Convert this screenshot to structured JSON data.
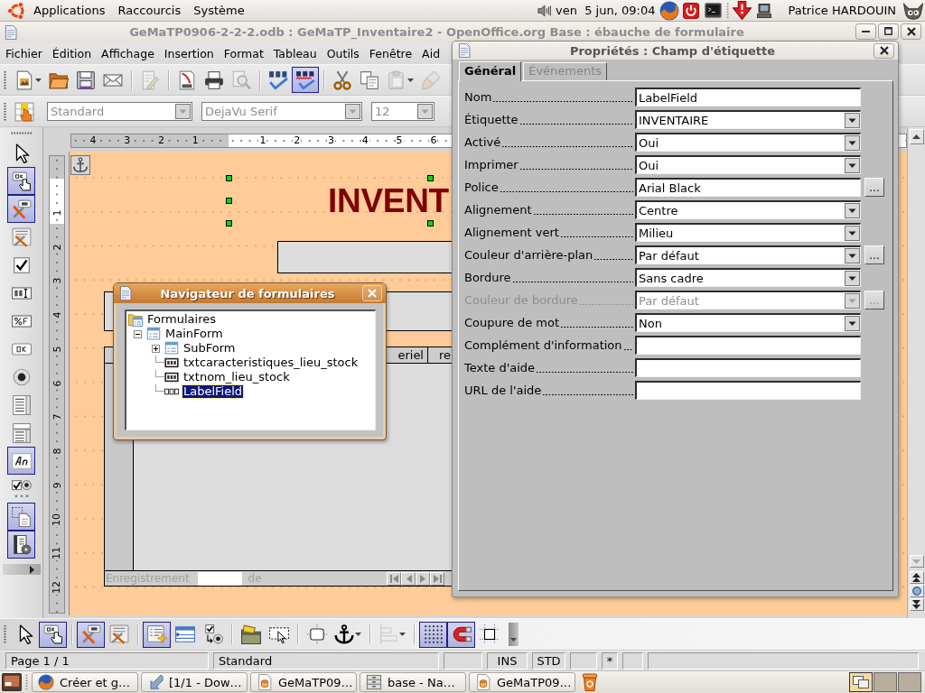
{
  "top_panel": {
    "menus": [
      "Applications",
      "Raccourcis",
      "Système"
    ],
    "clock": "ven  5 jun, 09:04",
    "user": "Patrice HARDOUIN"
  },
  "window": {
    "title": "GeMaTP0906-2-2-2.odb : GeMaTP_Inventaire2 - OpenOffice.org Base : ébauche de formulaire"
  },
  "menu_bar": [
    "Fichier",
    "Édition",
    "Affichage",
    "Insertion",
    "Format",
    "Tableau",
    "Outils",
    "Fenêtre",
    "Aid"
  ],
  "standard_toolbar": [
    [
      {
        "kind": "new",
        "on": false,
        "disabled": false,
        "menu": true
      },
      {
        "kind": "open",
        "on": false,
        "disabled": false
      },
      {
        "kind": "save",
        "on": false,
        "disabled": false
      },
      {
        "kind": "mail",
        "on": false,
        "disabled": false
      }
    ],
    [
      {
        "kind": "edit",
        "on": false,
        "disabled": true
      }
    ],
    [
      {
        "kind": "pdf",
        "on": false,
        "disabled": false
      },
      {
        "kind": "print",
        "on": false,
        "disabled": false
      },
      {
        "kind": "preview",
        "on": false,
        "disabled": true
      }
    ],
    [
      {
        "kind": "spellcheck",
        "on": false,
        "disabled": false
      },
      {
        "kind": "autospell",
        "on": true,
        "disabled": false
      }
    ],
    [
      {
        "kind": "cut",
        "on": false,
        "disabled": false
      },
      {
        "kind": "copy",
        "on": false,
        "disabled": false
      },
      {
        "kind": "paste",
        "on": false,
        "disabled": true,
        "menu": true
      },
      {
        "kind": "brush",
        "on": false,
        "disabled": true
      }
    ]
  ],
  "format_toolbar": {
    "tool": {
      "kind": "form-design",
      "on": false,
      "disabled": false
    },
    "paragraph_style": {
      "value": "Standard",
      "disabled": true
    },
    "font_name": {
      "value": "DejaVu Serif",
      "disabled": true
    },
    "font_size": {
      "value": "12",
      "disabled": true
    }
  },
  "controls_toolbar": [
    {
      "kind": "pointer",
      "on": false,
      "disabled": false
    },
    {
      "kind": "design-mode",
      "on": true,
      "disabled": false
    },
    {
      "kind": "control-properties",
      "on": true,
      "disabled": false
    },
    {
      "kind": "form-properties",
      "on": false,
      "disabled": false
    },
    {
      "kind": "checkbox",
      "on": false,
      "disabled": false
    },
    {
      "kind": "text-field",
      "on": false,
      "disabled": false
    },
    {
      "kind": "formatted-field",
      "on": false,
      "disabled": false
    },
    {
      "kind": "push-button",
      "on": false,
      "disabled": false
    },
    {
      "kind": "radio",
      "on": false,
      "disabled": false
    },
    {
      "kind": "list-box",
      "on": false,
      "disabled": false
    },
    {
      "kind": "combo-box",
      "on": false,
      "disabled": false
    },
    {
      "kind": "label",
      "on": true,
      "disabled": false
    },
    {
      "kind": "group-box",
      "on": false,
      "disabled": false
    },
    {
      "kind": "form-frame",
      "on": true,
      "disabled": false
    },
    {
      "kind": "form-wizard",
      "on": true,
      "disabled": false
    }
  ],
  "rulers": {
    "horizontal": {
      "before_origin": [
        "4",
        "3",
        "2",
        "1"
      ],
      "after_origin": [
        "1",
        "2",
        "3",
        "4",
        "5",
        "6"
      ]
    },
    "vertical": [
      "1",
      "2",
      "3",
      "4",
      "5",
      "6",
      "7",
      "8",
      "9",
      "10",
      "11",
      "12"
    ]
  },
  "form": {
    "label": {
      "text": "INVENT",
      "selected": true
    },
    "grid": {
      "columns": [
        "eriel",
        "re"
      ],
      "record_label": "Enregistrement",
      "record_of": "de"
    }
  },
  "form_navigator": {
    "title": "Navigateur de formulaires",
    "tree": [
      {
        "label": "Formulaires",
        "kind": "forms",
        "selected": false,
        "children": [
          {
            "label": "MainForm",
            "kind": "form",
            "expanded": true,
            "selected": false,
            "children": [
              {
                "label": "SubForm",
                "kind": "form",
                "expanded": false,
                "selected": false
              },
              {
                "label": "txtcaracteristiques_lieu_stock",
                "kind": "text-box",
                "selected": false
              },
              {
                "label": "txtnom_lieu_stock",
                "kind": "text-box",
                "selected": false
              },
              {
                "label": "LabelField",
                "kind": "label",
                "selected": true
              }
            ]
          }
        ]
      }
    ]
  },
  "properties_dialog": {
    "title": "Propriétés : Champ d'étiquette",
    "tabs": [
      {
        "label": "Général",
        "selected": true
      },
      {
        "label": "Événements",
        "selected": false
      }
    ],
    "rows": [
      {
        "label": "Nom",
        "kind": "text",
        "value": "LabelField",
        "disabled": false
      },
      {
        "label": "Étiquette",
        "kind": "select",
        "value": "INVENTAIRE",
        "disabled": false
      },
      {
        "label": "Activé",
        "kind": "select",
        "value": "Oui",
        "disabled": false
      },
      {
        "label": "Imprimer",
        "kind": "select",
        "value": "Oui",
        "disabled": false
      },
      {
        "label": "Police",
        "kind": "text",
        "value": "Arial Black",
        "disabled": false,
        "button": "..."
      },
      {
        "label": "Alignement",
        "kind": "select",
        "value": "Centre",
        "disabled": false
      },
      {
        "label": "Alignement vert",
        "kind": "select",
        "value": "Milieu",
        "disabled": false
      },
      {
        "label": "Couleur d'arrière-plan",
        "kind": "select",
        "value": "Par défaut",
        "disabled": false,
        "button": "..."
      },
      {
        "label": "Bordure",
        "kind": "select",
        "value": "Sans cadre",
        "disabled": false
      },
      {
        "label": "Couleur de bordure",
        "kind": "select",
        "value": "Par défaut",
        "disabled": true,
        "button": "..."
      },
      {
        "label": "Coupure de mot",
        "kind": "select",
        "value": "Non",
        "disabled": false
      },
      {
        "label": "Complément d'information",
        "kind": "text",
        "disabled": false
      },
      {
        "label": "Texte d'aide",
        "kind": "text",
        "disabled": false
      },
      {
        "label": "URL de l'aide",
        "kind": "text",
        "disabled": false
      }
    ]
  },
  "design_toolbar": [
    [
      {
        "kind": "pointer",
        "on": false,
        "disabled": false
      },
      {
        "kind": "design-mode",
        "on": true,
        "disabled": false
      }
    ],
    [
      {
        "kind": "control-properties",
        "on": true,
        "disabled": false
      },
      {
        "kind": "form-properties",
        "on": false,
        "disabled": false
      }
    ],
    [
      {
        "kind": "navigator",
        "on": true,
        "disabled": false
      },
      {
        "kind": "add-field",
        "on": false,
        "disabled": false
      },
      {
        "kind": "activation-order",
        "on": false,
        "disabled": false
      }
    ],
    [
      {
        "kind": "open-design",
        "on": false,
        "disabled": false
      },
      {
        "kind": "auto-focus",
        "on": false,
        "disabled": false
      }
    ],
    [
      {
        "kind": "position-size",
        "on": false,
        "disabled": false
      },
      {
        "kind": "anchor",
        "on": false,
        "disabled": false,
        "menu": true
      }
    ],
    [
      {
        "kind": "align",
        "on": false,
        "disabled": true,
        "menu": true
      }
    ],
    [
      {
        "kind": "grid",
        "on": true,
        "disabled": false
      },
      {
        "kind": "snap",
        "on": true,
        "disabled": false
      },
      {
        "kind": "guides",
        "on": false,
        "disabled": false
      }
    ]
  ],
  "status_bar": {
    "page": "Page 1 / 1",
    "page_style": "Standard",
    "insert_mode": "INS",
    "selection_mode": "STD",
    "modified": "*"
  },
  "taskbar": {
    "tasks": [
      {
        "label": "Créer et g…",
        "kind": "browser",
        "selected": false
      },
      {
        "label": "[1/1 - Dow…",
        "kind": "download",
        "selected": false
      },
      {
        "label": "GeMaTP09…",
        "kind": "document",
        "selected": false
      },
      {
        "label": "base - Na…",
        "kind": "files",
        "selected": false
      },
      {
        "label": "GeMaTP09…",
        "kind": "document",
        "selected": false
      }
    ],
    "workspaces": [
      {
        "selected": true
      },
      {
        "selected": false
      },
      {
        "selected": false
      }
    ]
  }
}
